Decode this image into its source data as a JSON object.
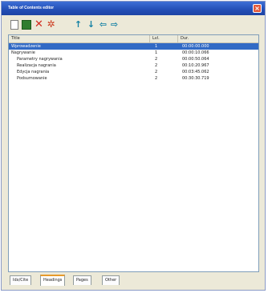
{
  "window": {
    "title": "Table of Contents editor",
    "close_glyph": "×"
  },
  "toolbar": {
    "icons": [
      "new-document-icon",
      "save-icon",
      "delete-icon",
      "settings-icon",
      "move-up-icon",
      "move-down-icon",
      "outdent-icon",
      "indent-icon"
    ],
    "glyphs": {
      "delete": "✕",
      "settings": "✲",
      "up": "↑",
      "down": "↓",
      "left": "⇦",
      "right": "⇨"
    }
  },
  "list": {
    "columns": {
      "title": "Title",
      "level": "Lvl.",
      "duration": "Dur."
    },
    "rows": [
      {
        "title": "Wprowadzenie",
        "level": "1",
        "duration": "00:00:00.000",
        "selected": true,
        "indent": false
      },
      {
        "title": "Nagrywanie",
        "level": "1",
        "duration": "00:00:10.066",
        "selected": false,
        "indent": false
      },
      {
        "title": "Parametry nagrywania",
        "level": "2",
        "duration": "00:00:50.064",
        "selected": false,
        "indent": true
      },
      {
        "title": "Realizacja nagrania",
        "level": "2",
        "duration": "00:10:20.967",
        "selected": false,
        "indent": true
      },
      {
        "title": "Edycja nagrania",
        "level": "2",
        "duration": "00:03:45.062",
        "selected": false,
        "indent": true
      },
      {
        "title": "Podsumowanie",
        "level": "2",
        "duration": "00:30:30.719",
        "selected": false,
        "indent": true
      }
    ]
  },
  "tabs": [
    "Idx/Cite",
    "Headings",
    "Pages",
    "Other"
  ],
  "active_tab": "Headings",
  "colors": {
    "titlebar": "#2450b8",
    "selection": "#316ac5",
    "tab_accent": "#e69a2b"
  }
}
